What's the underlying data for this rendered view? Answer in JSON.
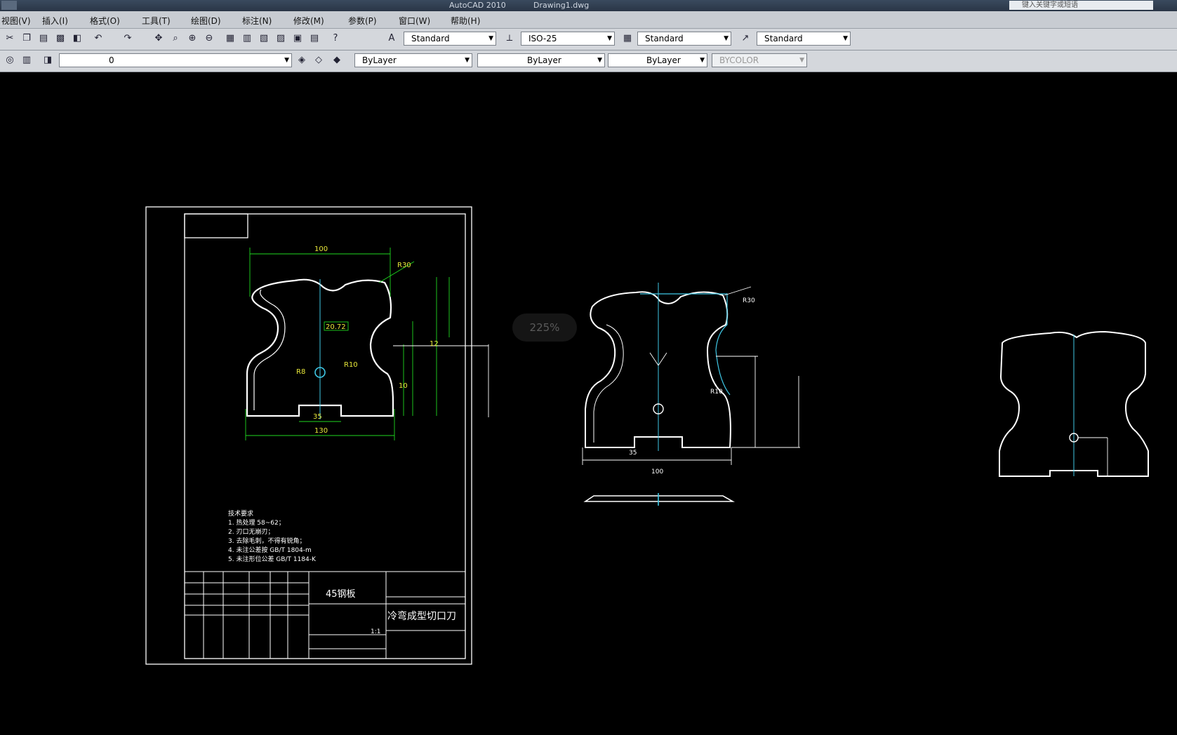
{
  "window": {
    "title_left": "AutoCAD 2010",
    "title_right": "Drawing1.dwg",
    "help_search_placeholder": "键入关键字或短语"
  },
  "menu": [
    "视图(V)",
    "插入(I)",
    "格式(O)",
    "工具(T)",
    "绘图(D)",
    "标注(N)",
    "修改(M)",
    "参数(P)",
    "窗口(W)",
    "帮助(H)"
  ],
  "styles_toolbar": {
    "text_style": "Standard",
    "dim_style": "ISO-25",
    "table_style": "Standard",
    "multileader_style": "Standard"
  },
  "layers_toolbar": {
    "layer": "0",
    "color": "ByLayer",
    "linetype": "ByLayer",
    "lineweight": "ByLayer",
    "plotstyle": "BYCOLOR"
  },
  "zoom_level": "225%",
  "drawing": {
    "dims": {
      "w100": "100",
      "w130": "130",
      "w35": "35",
      "r8": "R8",
      "r10": "R10",
      "d20": "20.72",
      "r30": "R30",
      "l12": "12",
      "l10": "10"
    },
    "tech_req": {
      "title": "技术要求",
      "lines": [
        "1. 热处理 58~62；",
        "2. 刃口无崩刃；",
        "3. 去除毛刺，不得有锐角；",
        "4. 未注公差按 GB/T 1804-m",
        "5. 未注形位公差 GB/T 1184-K"
      ]
    },
    "title_block": {
      "material": "45钢板",
      "part_name": "冷弯成型切口刀",
      "scale": "1:1"
    }
  },
  "colors": {
    "accent": "#2f6fcf",
    "cad_line": "#ffffff",
    "dim_green": "#1fd81f",
    "dim_yellow": "#e8e83a",
    "cad_cyan": "#3fc8e6"
  }
}
